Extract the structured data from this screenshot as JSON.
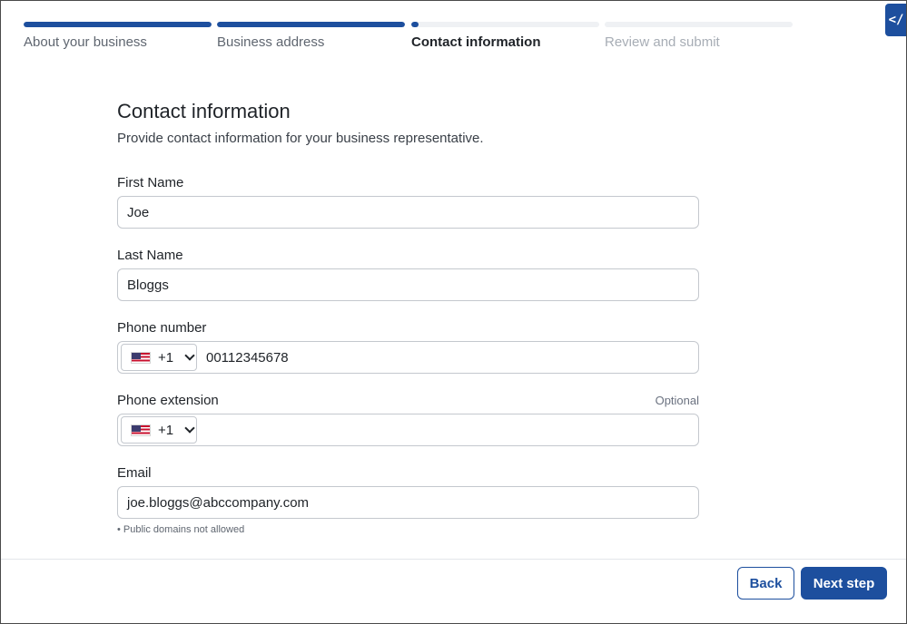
{
  "stepper": {
    "steps": [
      {
        "label": "About your business",
        "progress": 1.0,
        "state": "complete"
      },
      {
        "label": "Business address",
        "progress": 1.0,
        "state": "complete"
      },
      {
        "label": "Contact information",
        "progress": 0.04,
        "state": "active"
      },
      {
        "label": "Review and submit",
        "progress": 0,
        "state": "pending"
      }
    ]
  },
  "dev_tab": {
    "icon": "code-icon",
    "glyph": "</"
  },
  "form": {
    "title": "Contact information",
    "subtitle": "Provide contact information for your business representative.",
    "first_name": {
      "label": "First Name",
      "value": "Joe"
    },
    "last_name": {
      "label": "Last Name",
      "value": "Bloggs"
    },
    "phone": {
      "label": "Phone number",
      "country_code": "+1",
      "value": "00112345678"
    },
    "extension": {
      "label": "Phone extension",
      "optional": "Optional",
      "country_code": "+1",
      "value": ""
    },
    "email": {
      "label": "Email",
      "value": "joe.bloggs@abccompany.com",
      "hint": "• Public domains not allowed"
    }
  },
  "footer": {
    "back_label": "Back",
    "next_label": "Next step"
  },
  "colors": {
    "accent": "#1d4f9e",
    "border": "#c4c8ce",
    "track": "#eff1f4"
  }
}
